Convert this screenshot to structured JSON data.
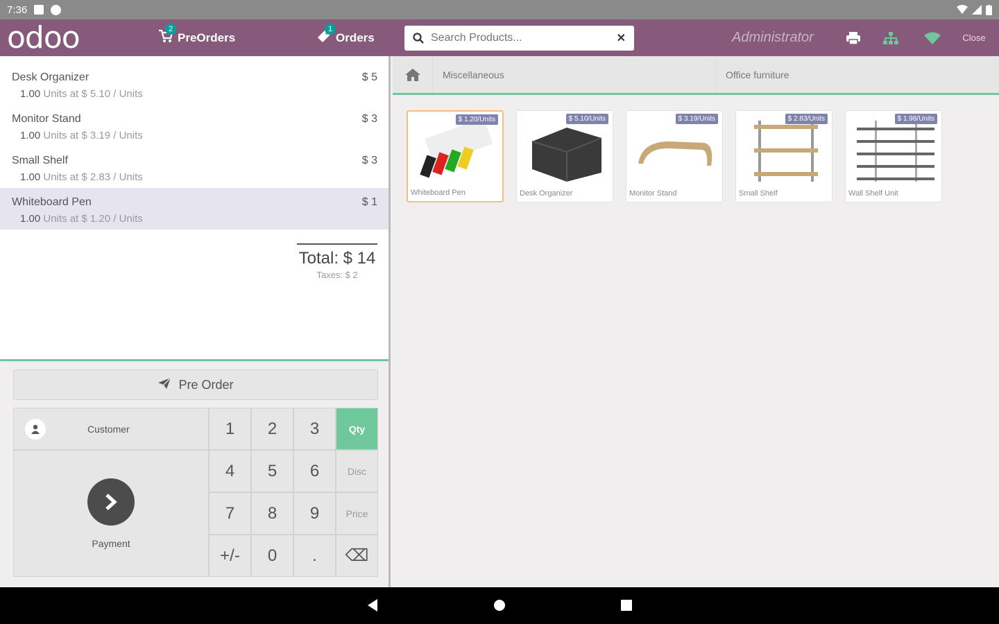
{
  "status_bar": {
    "time": "7:36"
  },
  "header": {
    "logo": "odoo",
    "preorders": {
      "label": "PreOrders",
      "badge": "2"
    },
    "orders": {
      "label": "Orders",
      "badge": "1"
    },
    "search_placeholder": "Search Products...",
    "user": "Administrator",
    "close_label": "Close"
  },
  "order": {
    "lines": [
      {
        "name": "Desk Organizer",
        "price": "$ 5",
        "qty": "1.00",
        "unit_info": "Units at $ 5.10 / Units"
      },
      {
        "name": "Monitor Stand",
        "price": "$ 3",
        "qty": "1.00",
        "unit_info": "Units at $ 3.19 / Units"
      },
      {
        "name": "Small Shelf",
        "price": "$ 3",
        "qty": "1.00",
        "unit_info": "Units at $ 2.83 / Units"
      },
      {
        "name": "Whiteboard Pen",
        "price": "$ 1",
        "qty": "1.00",
        "unit_info": "Units at $ 1.20 / Units"
      }
    ],
    "total": "Total: $ 14",
    "taxes": "Taxes: $ 2"
  },
  "controls": {
    "preorder_label": "Pre Order",
    "customer_label": "Customer",
    "payment_label": "Payment",
    "keys": [
      "1",
      "2",
      "3",
      "Qty",
      "4",
      "5",
      "6",
      "Disc",
      "7",
      "8",
      "9",
      "Price",
      "+/-",
      "0",
      ".",
      "⌫"
    ]
  },
  "categories": {
    "first": "Miscellaneous",
    "second": "Office furniture"
  },
  "products": [
    {
      "name": "Whiteboard Pen",
      "price": "$ 1.20/Units"
    },
    {
      "name": "Desk Organizer",
      "price": "$ 5.10/Units"
    },
    {
      "name": "Monitor Stand",
      "price": "$ 3.19/Units"
    },
    {
      "name": "Small Shelf",
      "price": "$ 2.83/Units"
    },
    {
      "name": "Wall Shelf Unit",
      "price": "$ 1.98/Units"
    }
  ],
  "colors": {
    "brand": "#875a7b",
    "accent": "#6ec89b",
    "badge": "#00a09d",
    "price_tag": "#7f82ac"
  }
}
